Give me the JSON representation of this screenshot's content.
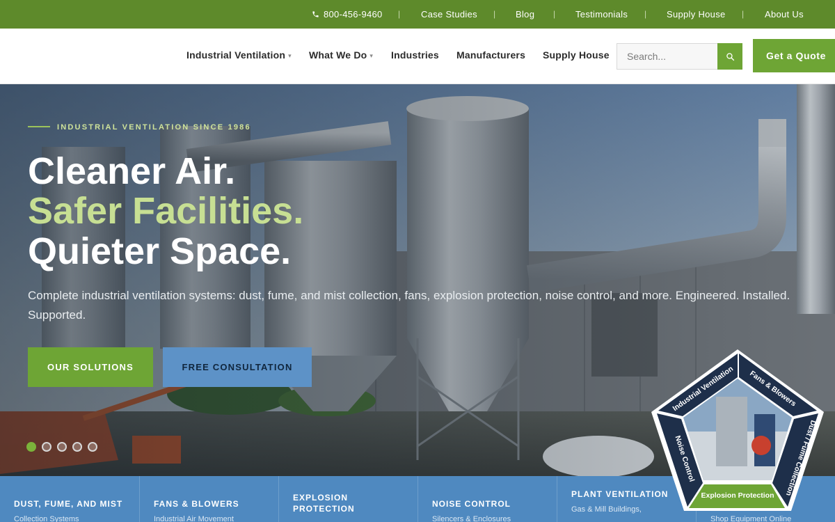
{
  "topbar": {
    "phone": "800-456-9460",
    "links": [
      "Case Studies",
      "Blog",
      "Testimonials",
      "Supply House",
      "About Us"
    ],
    "separator": "|"
  },
  "nav": {
    "items": [
      {
        "label": "Industrial Ventilation",
        "dropdown": true
      },
      {
        "label": "What We Do",
        "dropdown": true
      },
      {
        "label": "Industries",
        "dropdown": false
      },
      {
        "label": "Manufacturers",
        "dropdown": false
      },
      {
        "label": "Supply House",
        "dropdown": false
      }
    ],
    "caret": "▾",
    "search_placeholder": "Search...",
    "search_icon": "search-icon",
    "quote_label": "Get a Quote"
  },
  "hero": {
    "eyebrow": "INDUSTRIAL VENTILATION SINCE 1986",
    "headline_1": "Cleaner Air.",
    "headline_2": "Safer Facilities.",
    "headline_3": "Quieter Space.",
    "subtitle": "Complete industrial ventilation systems: dust, fume, and mist collection, fans, explosion protection, noise control, and more. Engineered. Installed. Supported.",
    "primary_button": "OUR SOLUTIONS",
    "secondary_button": "FREE CONSULTATION",
    "slides_count": 5,
    "active_slide": 1
  },
  "services": [
    {
      "title": "DUST, FUME, AND MIST",
      "subtitle": "Collection Systems"
    },
    {
      "title": "FANS & BLOWERS",
      "subtitle": "Industrial Air Movement"
    },
    {
      "title": "EXPLOSION PROTECTION",
      "subtitle": ""
    },
    {
      "title": "NOISE CONTROL",
      "subtitle": "Silencers & Enclosures"
    },
    {
      "title": "PLANT VENTILATION",
      "subtitle": "Gas & Mill Buildings,"
    },
    {
      "title": "",
      "subtitle": "Shop Equipment Online"
    }
  ],
  "badge": {
    "segments": [
      "Industrial Ventilation",
      "Fans & Blowers",
      "Dust / Fume Collection",
      "Explosion Protection",
      "Noise Control"
    ]
  },
  "colors": {
    "brand_green": "#6ea535",
    "topbar_green": "#5e8a2b",
    "accent_lime": "#c7df93",
    "brand_blue": "#4f89c0",
    "navy": "#1e2f4a"
  }
}
